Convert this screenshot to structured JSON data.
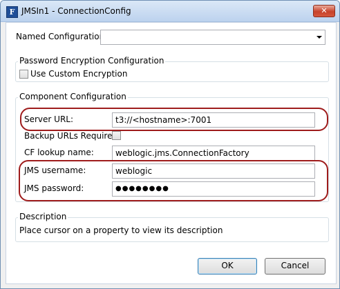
{
  "window": {
    "title": "JMSIn1 - ConnectionConfig",
    "app_icon": "F",
    "close_glyph": "✕"
  },
  "named_configuration": {
    "label": "Named Configuration",
    "value": ""
  },
  "password_encryption": {
    "title": "Password Encryption Configuration",
    "use_custom_label": "Use Custom Encryption",
    "use_custom_checked": false
  },
  "component_configuration": {
    "title": "Component Configuration",
    "server_url_label": "Server URL:",
    "server_url_value": "t3://<hostname>:7001",
    "backup_urls_label": "Backup URLs Required",
    "backup_urls_checked": false,
    "cf_lookup_label": "CF lookup name:",
    "cf_lookup_value": "weblogic.jms.ConnectionFactory",
    "jms_username_label": "JMS username:",
    "jms_username_value": "weblogic",
    "jms_password_label": "JMS password:",
    "jms_password_value": "●●●●●●●●"
  },
  "description": {
    "title": "Description",
    "text": "Place cursor on a property to view its description"
  },
  "buttons": {
    "ok": "OK",
    "cancel": "Cancel"
  },
  "colors": {
    "highlight_oval": "#9e1b1b",
    "title_bar": "#bcd2ee"
  }
}
